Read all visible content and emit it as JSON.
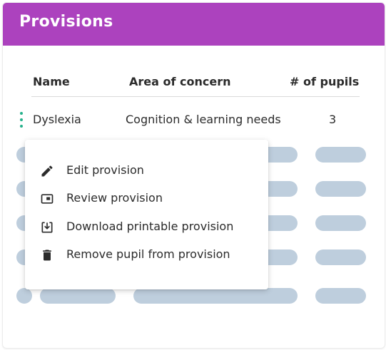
{
  "header": {
    "title": "Provisions",
    "color": "#ac42be"
  },
  "table": {
    "columns": [
      "Name",
      "Area of concern",
      "# of pupils"
    ],
    "rows": [
      {
        "name": "Dyslexia",
        "area": "Cognition & learning needs",
        "pupils": "3"
      }
    ]
  },
  "context_menu": {
    "items": [
      {
        "label": "Edit provision",
        "icon": "pencil-icon"
      },
      {
        "label": "Review provision",
        "icon": "review-icon"
      },
      {
        "label": "Download printable provision",
        "icon": "download-icon"
      },
      {
        "label": "Remove pupil from provision",
        "icon": "trash-icon"
      }
    ]
  },
  "colors": {
    "accent": "#25b18b",
    "placeholder": "#becedd"
  }
}
